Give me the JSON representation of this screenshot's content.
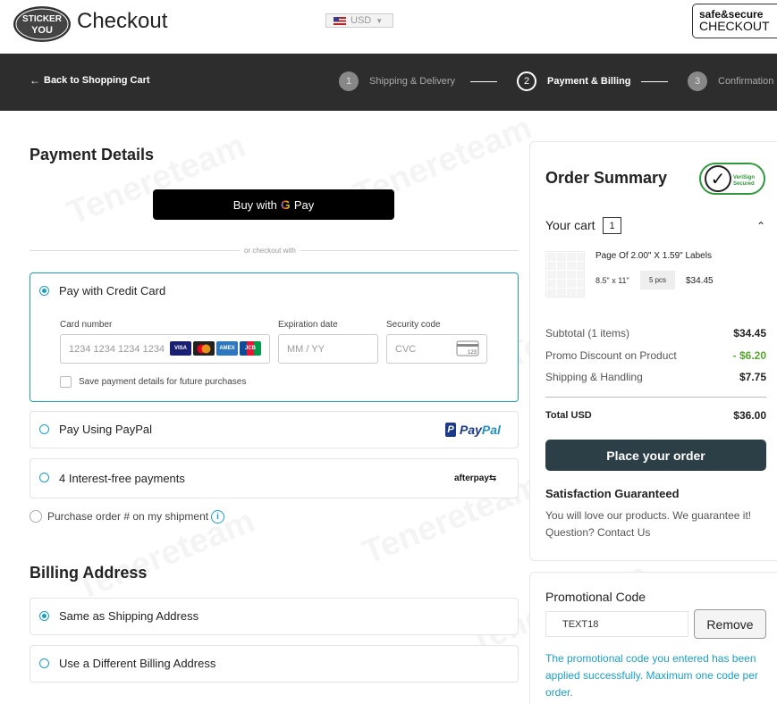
{
  "header": {
    "logo_text": "STICKER YOU",
    "title": "Checkout",
    "currency": "USD",
    "secure_line1": "safe&secure",
    "secure_line2": "CHECKOUT"
  },
  "nav": {
    "back_label": "Back to Shopping Cart",
    "steps": [
      {
        "number": "1",
        "label": "Shipping & Delivery"
      },
      {
        "number": "2",
        "label": "Payment & Billing"
      },
      {
        "number": "3",
        "label": "Confirmation"
      }
    ]
  },
  "payment": {
    "title": "Payment Details",
    "gpay_label": "Buy with",
    "gpay_g": "G",
    "gpay_pay": "Pay",
    "divider_text": "or checkout with",
    "credit_card": {
      "label": "Pay with Credit Card",
      "card_number_label": "Card number",
      "card_number_placeholder": "1234 1234 1234 1234",
      "expiration_label": "Expiration date",
      "expiration_placeholder": "MM / YY",
      "security_label": "Security code",
      "security_placeholder": "CVC",
      "card_brands": [
        "VISA",
        "MC",
        "AMEX",
        "JCB"
      ],
      "save_label": "Save payment details for future purchases"
    },
    "paypal": {
      "label": "Pay Using PayPal",
      "logo_pay": "Pay",
      "logo_pal": "Pal"
    },
    "afterpay": {
      "label": "4 Interest-free payments",
      "logo": "afterpay"
    },
    "purchase_order_label": "Purchase order # on my shipment"
  },
  "billing": {
    "title": "Billing Address",
    "options": [
      "Same as Shipping Address",
      "Use a Different Billing Address"
    ]
  },
  "summary": {
    "title": "Order Summary",
    "verisign_line1": "VeriSign",
    "verisign_line2": "Secured",
    "cart_label": "Your cart",
    "cart_count": "1",
    "product": {
      "name": "Page Of 2.00\" X 1.59\" Labels",
      "size": "8.5\" x 11\"",
      "qty": "5 pcs",
      "price": "$34.45"
    },
    "rows": [
      {
        "label": "Subtotal (1 items)",
        "value": "$34.45"
      },
      {
        "label": "Promo Discount on Product",
        "value": "- $6.20"
      },
      {
        "label": "Shipping & Handling",
        "value": "$7.75"
      }
    ],
    "total_label": "Total USD",
    "total_value": "$36.00",
    "place_order_label": "Place your order",
    "satisfaction_title": "Satisfaction Guaranteed",
    "satisfaction_line1": "You will love our products. We guarantee it!",
    "satisfaction_line2": "Question? Contact Us"
  },
  "promo": {
    "title": "Promotional Code",
    "code": "TEXT18",
    "remove_label": "Remove",
    "message": "The promotional code you entered has been applied successfully. Maximum one code per order."
  },
  "colors": {
    "accent": "#1aa0c4",
    "dark_nav": "#2d2d2d",
    "place_order": "#2c3e46",
    "discount_green": "#5aa532"
  },
  "watermark": "Tenereteam"
}
